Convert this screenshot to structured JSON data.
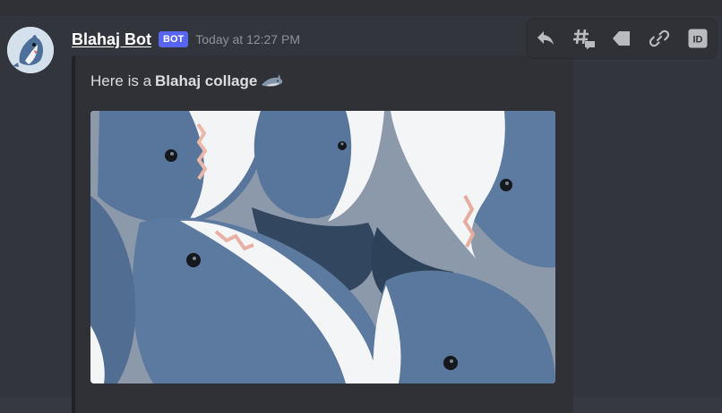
{
  "message": {
    "author": "Blahaj Bot",
    "badge": "BOT",
    "timestamp": "Today at 12:27 PM",
    "avatar_icon": "shark-avatar-icon"
  },
  "toolbar": {
    "items": [
      {
        "name": "reply",
        "icon": "reply-icon"
      },
      {
        "name": "create-thread",
        "icon": "thread-icon"
      },
      {
        "name": "mark-unread",
        "icon": "flag-icon"
      },
      {
        "name": "copy-link",
        "icon": "link-icon"
      },
      {
        "name": "copy-id",
        "icon": "id-icon",
        "label": "ID"
      }
    ]
  },
  "embed": {
    "desc_prefix": "Here is a ",
    "desc_bold": "Blahaj collage",
    "emoji": "shark-emoji",
    "image": "blahaj-collage-image"
  },
  "colors": {
    "background": "#36393f",
    "message_bg": "#32353b",
    "embed_bg": "#2f3136",
    "embed_border": "#202225",
    "badge": "#5865f2",
    "timestamp": "#8e9297",
    "icon": "#b9bbbe"
  }
}
